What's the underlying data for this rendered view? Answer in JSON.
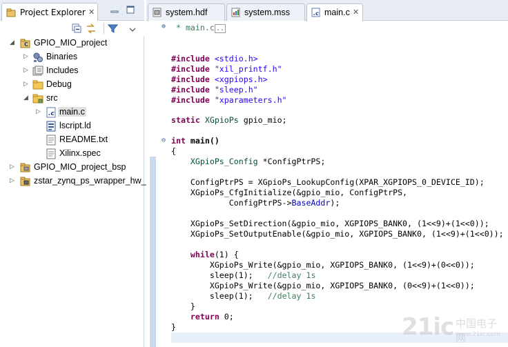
{
  "explorer": {
    "title": "Project Explorer",
    "tree": [
      {
        "label": "GPIO_MIO_project",
        "icon": "c-project-icon",
        "twisty": "expanded"
      },
      {
        "label": "Binaries",
        "icon": "binaries-folder-icon",
        "twisty": "collapsed"
      },
      {
        "label": "Includes",
        "icon": "includes-folder-icon",
        "twisty": "collapsed"
      },
      {
        "label": "Debug",
        "icon": "folder-icon",
        "twisty": "collapsed"
      },
      {
        "label": "src",
        "icon": "source-folder-icon",
        "twisty": "expanded"
      },
      {
        "label": "main.c",
        "icon": "c-file-icon",
        "twisty": "collapsed"
      },
      {
        "label": "lscript.ld",
        "icon": "linker-script-icon",
        "twisty": "none"
      },
      {
        "label": "README.txt",
        "icon": "text-file-icon",
        "twisty": "none"
      },
      {
        "label": "Xilinx.spec",
        "icon": "spec-file-icon",
        "twisty": "none"
      },
      {
        "label": "GPIO_MIO_project_bsp",
        "icon": "bsp-project-icon",
        "twisty": "collapsed"
      },
      {
        "label": "zstar_zynq_ps_wrapper_hw_",
        "icon": "hw-platform-icon",
        "twisty": "collapsed"
      }
    ]
  },
  "editor": {
    "tabs": [
      {
        "label": "system.hdf",
        "icon": "hdf-file-icon",
        "active": false
      },
      {
        "label": "system.mss",
        "icon": "mss-file-icon",
        "active": false
      },
      {
        "label": "main.c",
        "icon": "c-file-icon",
        "active": true
      }
    ],
    "folded_comment": "* main.c",
    "code": {
      "inc1": "<stdio.h>",
      "inc2": "\"xil_printf.h\"",
      "inc3": "<xgpiops.h>",
      "inc4": "\"sleep.h\"",
      "inc5": "\"xparameters.h\"",
      "include_kw": "#include",
      "static_kw": "static",
      "gpio_type": "XGpioPs",
      "gpio_var": " gpio_mio;",
      "int_kw": "int",
      "main_sig": " main()",
      "open_brace": "{",
      "cfg_type": "XGpioPs_Config",
      "cfg_decl": " *ConfigPtrPS;",
      "lookup_pre": "ConfigPtrPS = XGpioPs_LookupConfig(XPAR_XGPIOPS_0_DEVICE_ID);",
      "cfginit_pre": "XGpioPs_CfgInitialize(&gpio_mio, ConfigPtrPS,",
      "cfginit_cont_pre": "        ConfigPtrPS->",
      "base_addr": "BaseAddr",
      "cfginit_end": ");",
      "setdir": "XGpioPs_SetDirection(&gpio_mio, XGPIOPS_BANK0, (1<<9)+(1<<0));",
      "setout": "XGpioPs_SetOutputEnable(&gpio_mio, XGPIOPS_BANK0, (1<<9)+(1<<0));",
      "while_kw": "while",
      "while_rest": "(1) {",
      "write1": "XGpioPs_Write(&gpio_mio, XGPIOPS_BANK0, (1<<9)+(0<<0));",
      "sleep1": "sleep(1);",
      "delay_cm": "//delay 1s",
      "write2": "XGpioPs_Write(&gpio_mio, XGPIOPS_BANK0, (0<<9)+(1<<0));",
      "close_inner": "}",
      "return_kw": "return",
      "return_rest": " 0;",
      "close_brace": "}"
    }
  },
  "watermark": {
    "brand": "21ic",
    "cn": "中国电子网",
    "url": "www.21ic.com"
  }
}
